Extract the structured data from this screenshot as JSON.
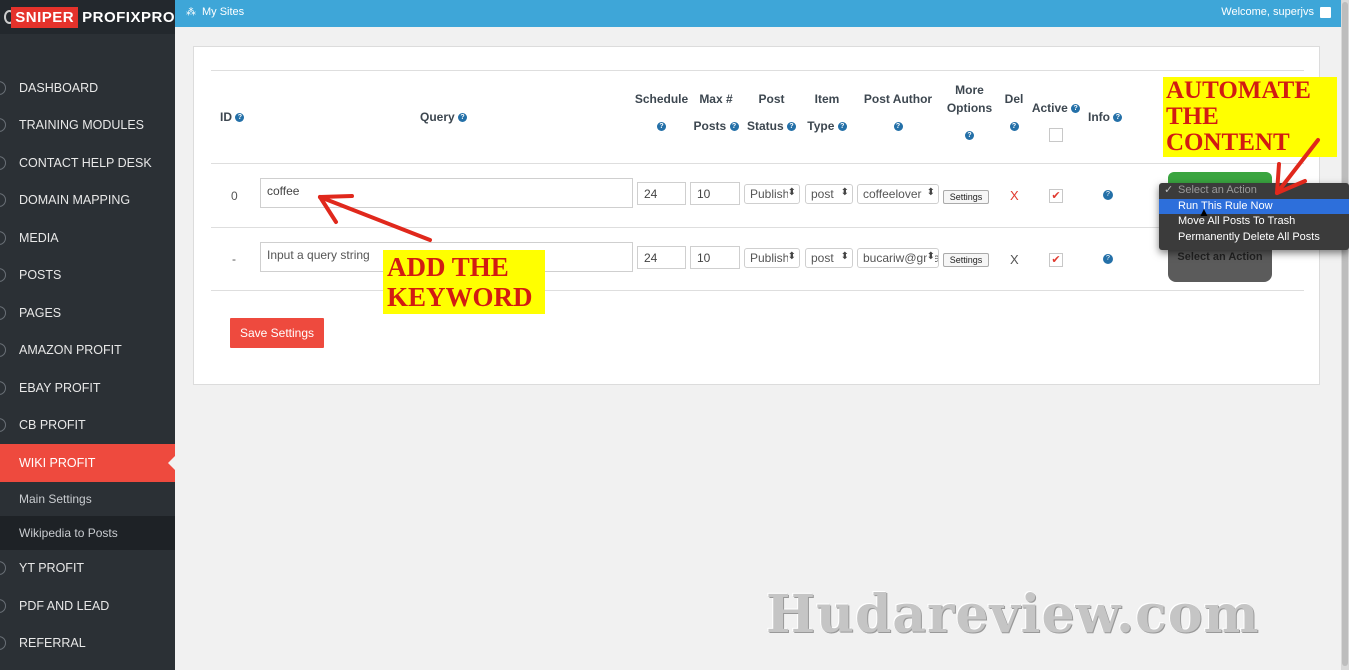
{
  "app": {
    "logo_part1": "SNIPER",
    "logo_part2": "PROFIXPRO"
  },
  "topbar": {
    "my_sites": "My Sites",
    "welcome": "Welcome, superjvs"
  },
  "sidebar": {
    "items": [
      {
        "label": "DASHBOARD"
      },
      {
        "label": "TRAINING MODULES"
      },
      {
        "label": "CONTACT HELP DESK"
      },
      {
        "label": "DOMAIN MAPPING"
      },
      {
        "label": "MEDIA"
      },
      {
        "label": "POSTS"
      },
      {
        "label": "PAGES"
      },
      {
        "label": "AMAZON PROFIT"
      },
      {
        "label": "EBAY PROFIT"
      },
      {
        "label": "CB PROFIT"
      },
      {
        "label": "WIKI PROFIT",
        "active": true
      }
    ],
    "sub_items": [
      {
        "label": "Main Settings"
      },
      {
        "label": "Wikipedia to Posts"
      }
    ],
    "items_after": [
      {
        "label": "YT PROFIT"
      },
      {
        "label": "PDF AND LEAD"
      },
      {
        "label": "REFERRAL"
      }
    ]
  },
  "table": {
    "headers": {
      "id": "ID",
      "query": "Query",
      "schedule": "Schedule",
      "max_posts_1": "Max #",
      "max_posts_2": "Posts",
      "post_status_1": "Post",
      "post_status_2": "Status",
      "item_type_1": "Item",
      "item_type_2": "Type",
      "post_author": "Post Author",
      "more_options_1": "More",
      "more_options_2": "Options",
      "del": "Del",
      "active": "Active",
      "info": "Info"
    },
    "rows": [
      {
        "id": "0",
        "query_value": "coffee",
        "schedule": "24",
        "max_posts": "10",
        "post_status": "Publish",
        "item_type": "post",
        "post_author": "coffeelover",
        "settings_label": "Settings",
        "del": "X",
        "active_check": "✔",
        "info": "?"
      },
      {
        "id": "-",
        "query_placeholder": "Input a query string",
        "schedule": "24",
        "max_posts": "10",
        "post_status": "Publish",
        "item_type": "post",
        "post_author": "bucariw@gmail.com",
        "settings_label": "Settings",
        "del": "X",
        "active_check": "✔",
        "info": "?"
      }
    ]
  },
  "actions": {
    "dropdown_options": [
      "Select an Action",
      "Run This Rule Now",
      "Move All Posts To Trash",
      "Permanently Delete All Posts"
    ],
    "selected": "Select an Action",
    "highlighted": "Run This Rule Now",
    "row2_label": "Select an Action"
  },
  "save_button": "Save Settings",
  "annotations": {
    "add_keyword_1": "ADD THE",
    "add_keyword_2": "KEYWORD",
    "automate_1": "AUTOMATE",
    "automate_2": "THE CONTENT",
    "watermark": "Hudareview.com"
  },
  "colors": {
    "sidebar_bg": "#2b3035",
    "active_red": "#ee4a3e",
    "topbar_blue": "#3ea6d8",
    "annotation_yellow": "#ffff00",
    "annotation_red": "#d21b12"
  }
}
